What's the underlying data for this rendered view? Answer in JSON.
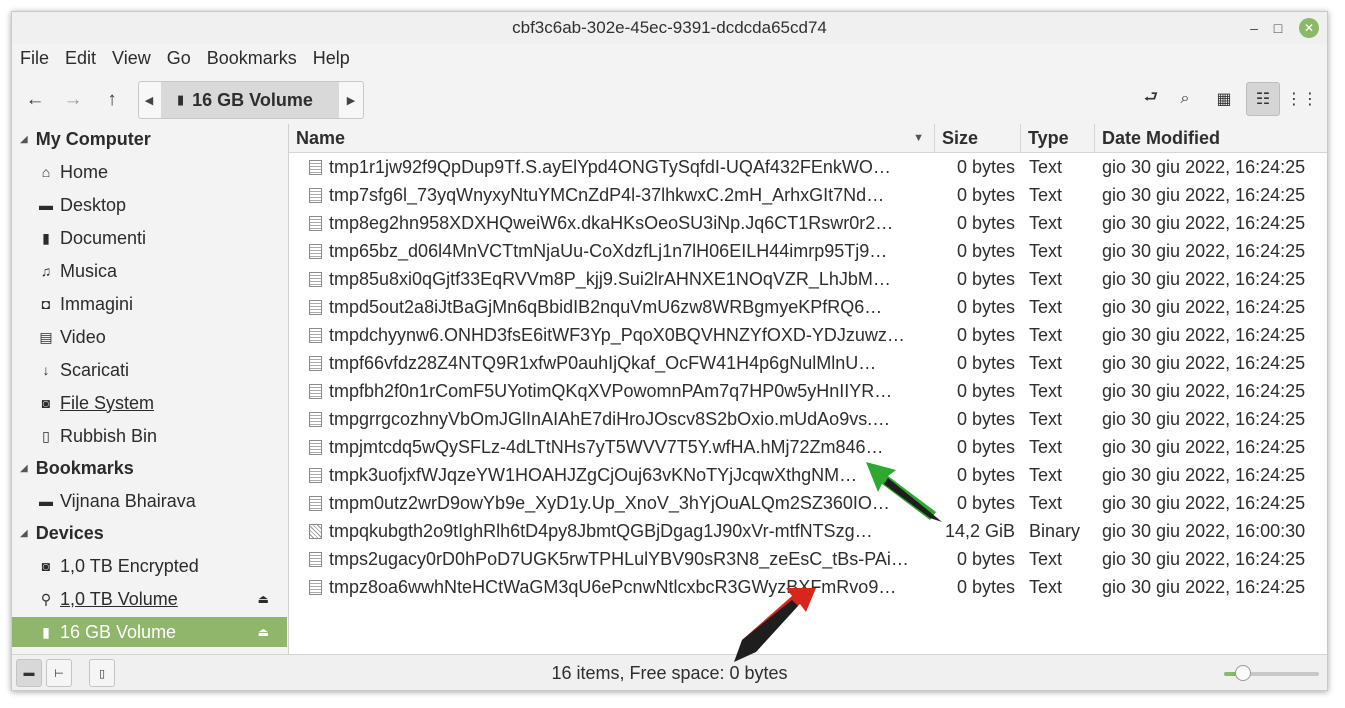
{
  "window": {
    "title": "cbf3c6ab-302e-45ec-9391-dcdcda65cd74",
    "minimize_glyph": "–",
    "maximize_glyph": "□",
    "close_glyph": "✕"
  },
  "menubar": [
    "File",
    "Edit",
    "View",
    "Go",
    "Bookmarks",
    "Help"
  ],
  "toolbar": {
    "back_icon": "←",
    "forward_icon": "→",
    "up_icon": "↑",
    "path_left_glyph": "◀",
    "path_right_glyph": "▶",
    "path_segment": "16 GB Volume",
    "toggle_location_icon": "⮐",
    "search_icon": "⌕",
    "icon_view_icon": "▦",
    "list_view_icon": "☷",
    "compact_view_icon": "⋮⋮"
  },
  "sidebar": {
    "sections": [
      {
        "title": "My Computer",
        "items": [
          {
            "label": "Home",
            "icon": "⌂"
          },
          {
            "label": "Desktop",
            "icon": "▬"
          },
          {
            "label": "Documenti",
            "icon": "▮"
          },
          {
            "label": "Musica",
            "icon": "♫"
          },
          {
            "label": "Immagini",
            "icon": "◘"
          },
          {
            "label": "Video",
            "icon": "▤"
          },
          {
            "label": "Scaricati",
            "icon": "↓"
          },
          {
            "label": "File System",
            "icon": "◙"
          },
          {
            "label": "Rubbish Bin",
            "icon": "▯"
          }
        ]
      },
      {
        "title": "Bookmarks",
        "items": [
          {
            "label": "Vijnana Bhairava",
            "icon": "▬"
          }
        ]
      },
      {
        "title": "Devices",
        "items": [
          {
            "label": "1,0 TB Encrypted",
            "icon": "◙"
          },
          {
            "label": "1,0 TB Volume",
            "icon": "⚲",
            "eject": "⏏"
          },
          {
            "label": "16 GB Volume",
            "icon": "▮",
            "eject": "⏏"
          }
        ]
      }
    ],
    "section_toggle_glyph": "◢"
  },
  "list": {
    "columns": {
      "name": "Name",
      "size": "Size",
      "type": "Type",
      "date": "Date Modified"
    },
    "sort_glyph": "▼",
    "rows": [
      {
        "name": "tmp1r1jw92f9QpDup9Tf.S.ayElYpd4ONGTySqfdI-UQAf432FEnkWO…",
        "size": "0 bytes",
        "type": "Text",
        "date": "gio 30 giu 2022, 16:24:25"
      },
      {
        "name": "tmp7sfg6l_73yqWnyxyNtuYMCnZdP4l-37lhkwxC.2mH_ArhxGIt7Nd…",
        "size": "0 bytes",
        "type": "Text",
        "date": "gio 30 giu 2022, 16:24:25"
      },
      {
        "name": "tmp8eg2hn958XDXHQweiW6x.dkaHKsOeoSU3iNp.Jq6CT1Rswr0r2…",
        "size": "0 bytes",
        "type": "Text",
        "date": "gio 30 giu 2022, 16:24:25"
      },
      {
        "name": "tmp65bz_d06l4MnVCTtmNjaUu-CoXdzfLj1n7lH06EILH44imrp95Tj9…",
        "size": "0 bytes",
        "type": "Text",
        "date": "gio 30 giu 2022, 16:24:25"
      },
      {
        "name": "tmp85u8xi0qGjtf33EqRVVm8P_kjj9.Sui2lrAHNXE1NOqVZR_LhJbM…",
        "size": "0 bytes",
        "type": "Text",
        "date": "gio 30 giu 2022, 16:24:25"
      },
      {
        "name": "tmpd5out2a8iJtBaGjMn6qBbidIB2nquVmU6zw8WRBgmyeKPfRQ6…",
        "size": "0 bytes",
        "type": "Text",
        "date": "gio 30 giu 2022, 16:24:25"
      },
      {
        "name": "tmpdchyynw6.ONHD3fsE6itWF3Yp_PqoX0BQVHNZYfOXD-YDJzuwz…",
        "size": "0 bytes",
        "type": "Text",
        "date": "gio 30 giu 2022, 16:24:25"
      },
      {
        "name": "tmpf66vfdz28Z4NTQ9R1xfwP0auhIjQkaf_OcFW41H4p6gNulMlnU…",
        "size": "0 bytes",
        "type": "Text",
        "date": "gio 30 giu 2022, 16:24:25"
      },
      {
        "name": "tmpfbh2f0n1rComF5UYotimQKqXVPowomnPAm7q7HP0w5yHnIIYR…",
        "size": "0 bytes",
        "type": "Text",
        "date": "gio 30 giu 2022, 16:24:25"
      },
      {
        "name": "tmpgrrgcozhnyVbOmJGlInAIAhE7diHroJOscv8S2bOxio.mUdAo9vs.…",
        "size": "0 bytes",
        "type": "Text",
        "date": "gio 30 giu 2022, 16:24:25"
      },
      {
        "name": "tmpjmtcdq5wQySFLz-4dLTtNHs7yT5WVV7T5Y.wfHA.hMj72Zm846…",
        "size": "0 bytes",
        "type": "Text",
        "date": "gio 30 giu 2022, 16:24:25"
      },
      {
        "name": "tmpk3uofjxfWJqzeYW1HOAHJZgCjOuj63vKNoTYjJcqwXthgNM…",
        "size": "0 bytes",
        "type": "Text",
        "date": "gio 30 giu 2022, 16:24:25"
      },
      {
        "name": "tmpm0utz2wrD9owYb9e_XyD1y.Up_XnoV_3hYjOuALQm2SZ360IO…",
        "size": "0 bytes",
        "type": "Text",
        "date": "gio 30 giu 2022, 16:24:25"
      },
      {
        "name": "tmpqkubgth2o9tIghRlh6tD4py8JbmtQGBjDgag1J90xVr-mtfNTSzg…",
        "size": "14,2 GiB",
        "type": "Binary",
        "date": "gio 30 giu 2022, 16:00:30",
        "binary": true
      },
      {
        "name": "tmps2ugacy0rD0hPoD7UGK5rwTPHLulYBV90sR3N8_zeEsC_tBs-PAi…",
        "size": "0 bytes",
        "type": "Text",
        "date": "gio 30 giu 2022, 16:24:25"
      },
      {
        "name": "tmpz8oa6wwhNteHCtWaGM3qU6ePcnwNtlcxbcR3GWyzBXFmRvo9…",
        "size": "0 bytes",
        "type": "Text",
        "date": "gio 30 giu 2022, 16:24:25"
      }
    ]
  },
  "statusbar": {
    "text": "16 items, Free space: 0 bytes",
    "places_icon": "▬",
    "tree_icon": "⊢",
    "toggle_sidebar_icon": "▯",
    "zoom_level": 0.2
  },
  "annotations": {
    "arrow_colors": {
      "green": "#2ea82e",
      "red": "#d9261c",
      "dark": "#1e1e1e"
    }
  }
}
